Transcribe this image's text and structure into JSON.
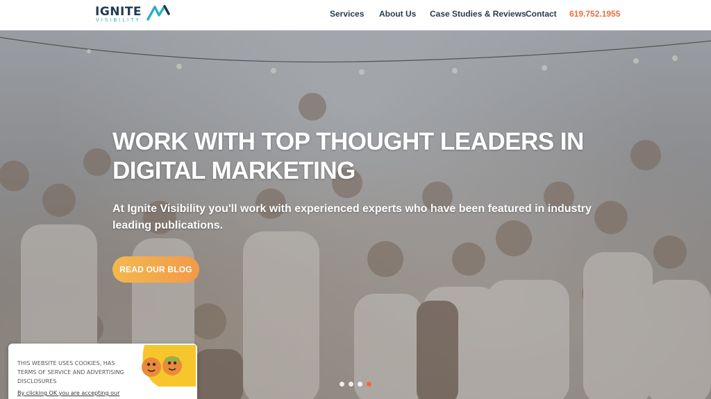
{
  "header": {
    "logo_word": "IGNITE",
    "logo_sub": "VISIBILITY",
    "nav": [
      {
        "label": "Services"
      },
      {
        "label": "About Us"
      },
      {
        "label": "Case Studies & Reviews"
      },
      {
        "label": "Contact"
      }
    ],
    "phone": "619.752.1955"
  },
  "hero": {
    "title": "WORK WITH TOP THOUGHT LEADERS IN DIGITAL MARKETING",
    "subtitle": "At Ignite Visibility you'll work with experienced experts who have been featured in industry leading publications.",
    "cta_label": "READ OUR BLOG",
    "slides_total": 4,
    "active_slide": 4
  },
  "cookie": {
    "text": "THIS WEBSITE USES COOKIES, HAS TERMS OF SERVICE AND ADVERTISING DISCLOSURES",
    "link": "By clicking OK you are accepting our"
  },
  "colors": {
    "brand_dark": "#1f3a52",
    "brand_teal": "#2bb0c8",
    "accent_orange": "#f06a3f",
    "cta_gradient_start": "#f3b84e",
    "cta_gradient_end": "#f29a4a"
  },
  "icons": [
    "ignite-logo-icon",
    "cookie-mascot-icon"
  ]
}
